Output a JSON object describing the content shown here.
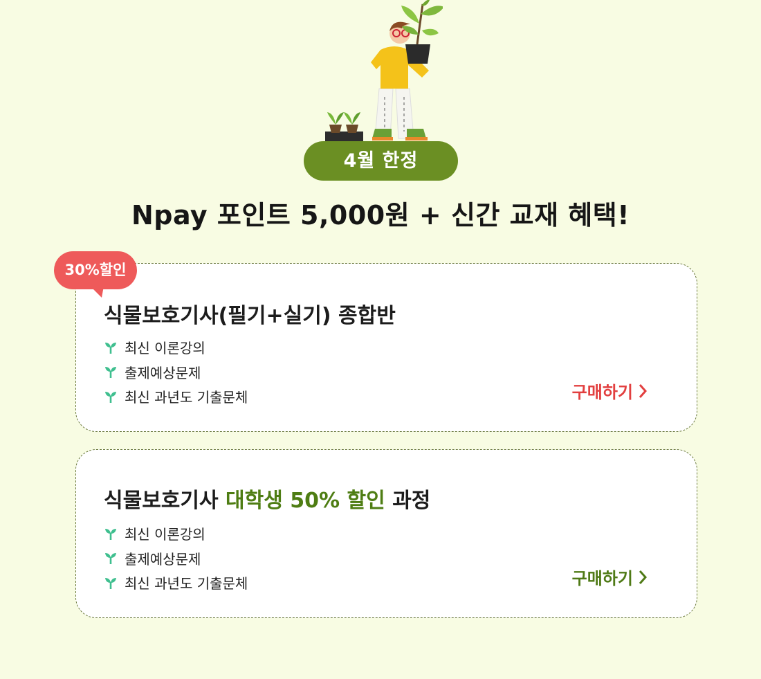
{
  "banner": {
    "badge": "4월 한정",
    "headline": "Npay 포인트 5,000원 + 신간 교재 혜택!"
  },
  "cards": [
    {
      "discount_tag": "30%할인",
      "title": "식물보호기사(필기+실기) 종합반",
      "features": [
        "최신 이론강의",
        "출제예상문제",
        "최신 과년도 기출문체"
      ],
      "cta": "구매하기"
    },
    {
      "title_prefix": "식물보호기사 ",
      "title_highlight": "대학생 50% 할인",
      "title_suffix": " 과정",
      "features": [
        "최신 이론강의",
        "출제예상문제",
        "최신 과년도 기출문체"
      ],
      "cta": "구매하기"
    }
  ],
  "colors": {
    "background": "#f8fce3",
    "accent_green": "#6b8f23",
    "highlight_green": "#4e7d13",
    "cta_red": "#e23f3f",
    "discount_red": "#ee5a5a"
  },
  "icons": [
    "sprout-icon",
    "chevron-right-icon"
  ]
}
